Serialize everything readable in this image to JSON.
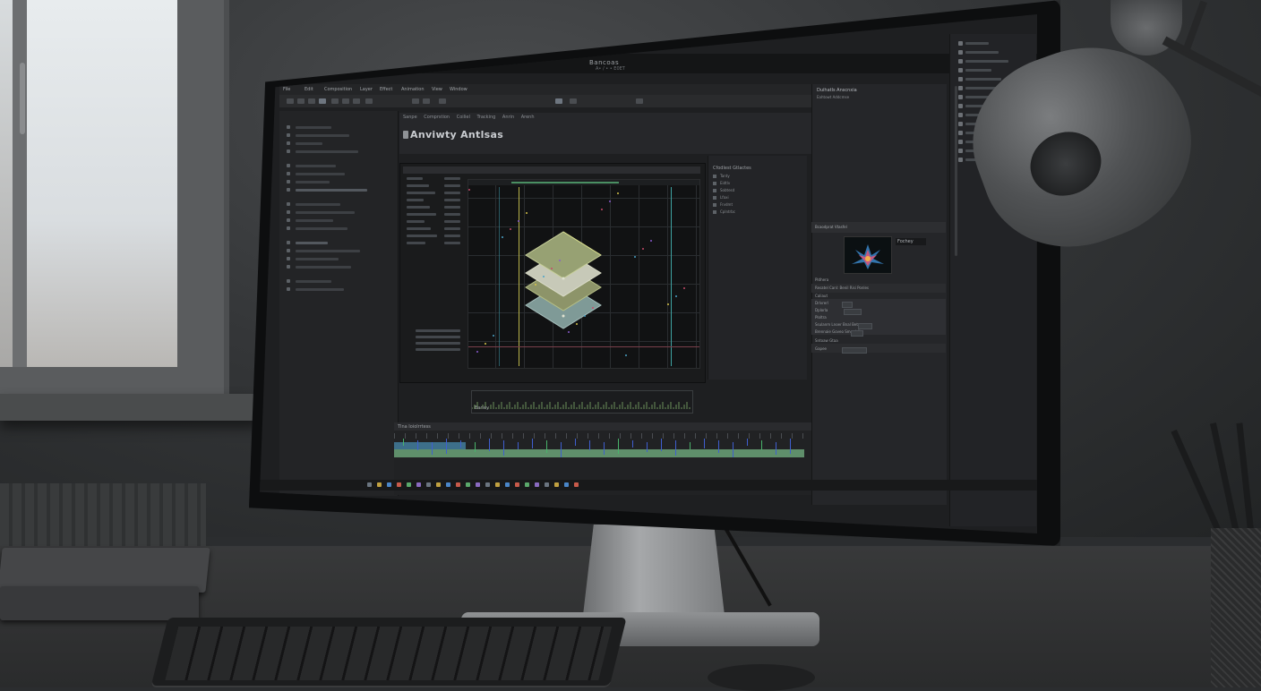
{
  "app": {
    "title": "Bancoas",
    "subtitle": "A• / • • E0ET",
    "composition_title": "Anviwty Antlsas"
  },
  "menu": [
    "File",
    "Edit",
    "Composition",
    "Layer",
    "Effect",
    "Animation",
    "View",
    "Window"
  ],
  "comp_tabs": [
    "Sanpe",
    "Comprstion",
    "Coiliel",
    "Tracking",
    "Anrin",
    "Arenh"
  ],
  "effects": {
    "title": "Cfodlest Gtlactes",
    "items": [
      "Tanty",
      "Eidtlv",
      "Sobtesd",
      "Lfaxi",
      "Frvdmt",
      "Cplntrbc"
    ]
  },
  "inspector": {
    "title": "Duihatls Anscnxia",
    "subtitle": "Eahtowt Addcmse",
    "asset_header": "Bcaodprat Vtasfel",
    "asset_name": "Fochey",
    "sections": [
      "Pldhera",
      "Resatel Canl: Benil Risi Ponles",
      "Caliaut"
    ],
    "rows": [
      "Drlvrerl",
      "Dplorla",
      "Ploltra",
      "Ssulanm Lnoer Bnal Betn",
      "Brennaie Goveo Smenloll",
      "Sntoaw Gtaa",
      "Gapee"
    ]
  },
  "timeline": {
    "label": "Tlna  Ioiolrrtess",
    "mini_label": "Bariey"
  },
  "colors": {
    "accent_green": "#5f8f6b",
    "accent_blue": "#3d6f8a",
    "guide_yellow": "#b9b34a",
    "guide_teal": "#3fa2a2",
    "guide_red": "#7a3f4a"
  }
}
